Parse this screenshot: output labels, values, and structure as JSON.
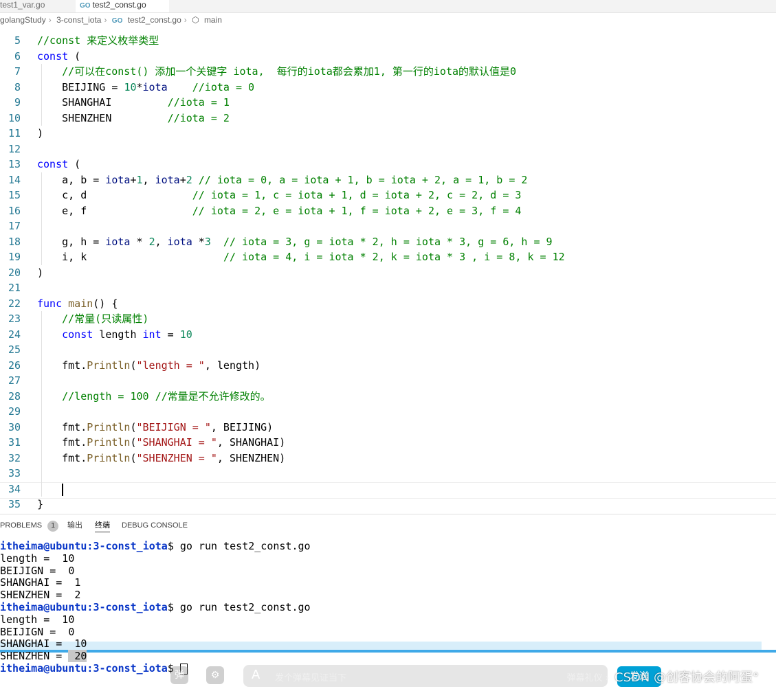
{
  "tabs": {
    "left_label": "test1_var.go",
    "active_label": "test2_const.go",
    "go_icon_text": "GO"
  },
  "breadcrumb": {
    "root": "golangStudy",
    "folder": "3-const_iota",
    "file": "test2_const.go",
    "symbol": "main"
  },
  "editor": {
    "lines": [
      {
        "n": "5",
        "t": [
          {
            "c": "cm",
            "v": "//const 来定义枚举类型"
          }
        ]
      },
      {
        "n": "6",
        "t": [
          {
            "c": "kw",
            "v": "const"
          },
          {
            "c": "plain",
            "v": " ("
          }
        ]
      },
      {
        "n": "7",
        "t": [
          {
            "c": "plain",
            "v": "    "
          },
          {
            "c": "cm",
            "v": "//可以在const() 添加一个关键字 iota,  每行的iota都会累加1, 第一行的iota的默认值是0"
          }
        ]
      },
      {
        "n": "8",
        "t": [
          {
            "c": "plain",
            "v": "    BEIJING = "
          },
          {
            "c": "num",
            "v": "10"
          },
          {
            "c": "plain",
            "v": "*"
          },
          {
            "c": "id",
            "v": "iota"
          },
          {
            "c": "plain",
            "v": "    "
          },
          {
            "c": "cm",
            "v": "//iota = 0"
          }
        ]
      },
      {
        "n": "9",
        "t": [
          {
            "c": "plain",
            "v": "    SHANGHAI         "
          },
          {
            "c": "cm",
            "v": "//iota = 1"
          }
        ]
      },
      {
        "n": "10",
        "t": [
          {
            "c": "plain",
            "v": "    SHENZHEN         "
          },
          {
            "c": "cm",
            "v": "//iota = 2"
          }
        ]
      },
      {
        "n": "11",
        "t": [
          {
            "c": "plain",
            "v": ")"
          }
        ]
      },
      {
        "n": "12",
        "t": []
      },
      {
        "n": "13",
        "t": [
          {
            "c": "kw",
            "v": "const"
          },
          {
            "c": "plain",
            "v": " ("
          }
        ]
      },
      {
        "n": "14",
        "t": [
          {
            "c": "plain",
            "v": "    a, b = "
          },
          {
            "c": "id",
            "v": "iota"
          },
          {
            "c": "plain",
            "v": "+"
          },
          {
            "c": "num",
            "v": "1"
          },
          {
            "c": "plain",
            "v": ", "
          },
          {
            "c": "id",
            "v": "iota"
          },
          {
            "c": "plain",
            "v": "+"
          },
          {
            "c": "num",
            "v": "2"
          },
          {
            "c": "plain",
            "v": " "
          },
          {
            "c": "cm",
            "v": "// iota = 0, a = iota + 1, b = iota + 2, a = 1, b = 2"
          }
        ]
      },
      {
        "n": "15",
        "t": [
          {
            "c": "plain",
            "v": "    c, d                 "
          },
          {
            "c": "cm",
            "v": "// iota = 1, c = iota + 1, d = iota + 2, c = 2, d = 3"
          }
        ]
      },
      {
        "n": "16",
        "t": [
          {
            "c": "plain",
            "v": "    e, f                 "
          },
          {
            "c": "cm",
            "v": "// iota = 2, e = iota + 1, f = iota + 2, e = 3, f = 4"
          }
        ]
      },
      {
        "n": "17",
        "t": []
      },
      {
        "n": "18",
        "t": [
          {
            "c": "plain",
            "v": "    g, h = "
          },
          {
            "c": "id",
            "v": "iota"
          },
          {
            "c": "plain",
            "v": " * "
          },
          {
            "c": "num",
            "v": "2"
          },
          {
            "c": "plain",
            "v": ", "
          },
          {
            "c": "id",
            "v": "iota"
          },
          {
            "c": "plain",
            "v": " *"
          },
          {
            "c": "num",
            "v": "3"
          },
          {
            "c": "plain",
            "v": "  "
          },
          {
            "c": "cm",
            "v": "// iota = 3, g = iota * 2, h = iota * 3, g = 6, h = 9"
          }
        ]
      },
      {
        "n": "19",
        "t": [
          {
            "c": "plain",
            "v": "    i, k                      "
          },
          {
            "c": "cm",
            "v": "// iota = 4, i = iota * 2, k = iota * 3 , i = 8, k = 12"
          }
        ]
      },
      {
        "n": "20",
        "t": [
          {
            "c": "plain",
            "v": ")"
          }
        ]
      },
      {
        "n": "21",
        "t": []
      },
      {
        "n": "22",
        "t": [
          {
            "c": "kw",
            "v": "func"
          },
          {
            "c": "plain",
            "v": " "
          },
          {
            "c": "fn",
            "v": "main"
          },
          {
            "c": "plain",
            "v": "() {"
          }
        ]
      },
      {
        "n": "23",
        "t": [
          {
            "c": "plain",
            "v": "    "
          },
          {
            "c": "cm",
            "v": "//常量(只读属性)"
          }
        ]
      },
      {
        "n": "24",
        "t": [
          {
            "c": "plain",
            "v": "    "
          },
          {
            "c": "kw",
            "v": "const"
          },
          {
            "c": "plain",
            "v": " length "
          },
          {
            "c": "kw",
            "v": "int"
          },
          {
            "c": "plain",
            "v": " = "
          },
          {
            "c": "num",
            "v": "10"
          }
        ]
      },
      {
        "n": "25",
        "t": []
      },
      {
        "n": "26",
        "t": [
          {
            "c": "plain",
            "v": "    fmt."
          },
          {
            "c": "fn",
            "v": "Println"
          },
          {
            "c": "plain",
            "v": "("
          },
          {
            "c": "str",
            "v": "\"length = \""
          },
          {
            "c": "plain",
            "v": ", length)"
          }
        ]
      },
      {
        "n": "27",
        "t": []
      },
      {
        "n": "28",
        "t": [
          {
            "c": "plain",
            "v": "    "
          },
          {
            "c": "cm",
            "v": "//length = 100 //常量是不允许修改的。"
          }
        ]
      },
      {
        "n": "29",
        "t": []
      },
      {
        "n": "30",
        "t": [
          {
            "c": "plain",
            "v": "    fmt."
          },
          {
            "c": "fn",
            "v": "Println"
          },
          {
            "c": "plain",
            "v": "("
          },
          {
            "c": "str",
            "v": "\"BEIJIGN = \""
          },
          {
            "c": "plain",
            "v": ", BEIJING)"
          }
        ]
      },
      {
        "n": "31",
        "t": [
          {
            "c": "plain",
            "v": "    fmt."
          },
          {
            "c": "fn",
            "v": "Println"
          },
          {
            "c": "plain",
            "v": "("
          },
          {
            "c": "str",
            "v": "\"SHANGHAI = \""
          },
          {
            "c": "plain",
            "v": ", SHANGHAI)"
          }
        ]
      },
      {
        "n": "32",
        "t": [
          {
            "c": "plain",
            "v": "    fmt."
          },
          {
            "c": "fn",
            "v": "Println"
          },
          {
            "c": "plain",
            "v": "("
          },
          {
            "c": "str",
            "v": "\"SHENZHEN = \""
          },
          {
            "c": "plain",
            "v": ", SHENZHEN)"
          }
        ]
      },
      {
        "n": "33",
        "t": []
      },
      {
        "n": "34",
        "t": []
      },
      {
        "n": "35",
        "t": [
          {
            "c": "plain",
            "v": "}"
          }
        ]
      }
    ]
  },
  "panel": {
    "problems_label": "PROBLEMS",
    "problems_count": "1",
    "output_label": "输出",
    "terminal_label": "终端",
    "debug_label": "DEBUG CONSOLE"
  },
  "terminal": {
    "prompt_user": "itheima@ubuntu",
    "prompt_path": ":3-const_iota",
    "lines": [
      {
        "type": "prompt",
        "cmd": "$ go run test2_const.go"
      },
      {
        "type": "out",
        "text": "length =  10"
      },
      {
        "type": "out",
        "text": "BEIJIGN =  0"
      },
      {
        "type": "out",
        "text": "SHANGHAI =  1"
      },
      {
        "type": "out",
        "text": "SHENZHEN =  2"
      },
      {
        "type": "prompt",
        "cmd": "$ go run test2_const.go"
      },
      {
        "type": "out",
        "text": "length =  10"
      },
      {
        "type": "out",
        "text": "BEIJIGN =  0"
      },
      {
        "type": "out",
        "text": "SHANGHAI =  10"
      },
      {
        "type": "out2",
        "text": "SHENZHEN = ",
        "sel": " 20"
      },
      {
        "type": "prompt",
        "cmd": "$ "
      }
    ]
  },
  "overlay": {
    "danmu_placeholder": "发个弹幕见证当下",
    "danmu_etiquette": "弹幕礼仪 ›",
    "send_label": "发送",
    "watermark": "CSDN @创客协会的阿蛋°"
  }
}
